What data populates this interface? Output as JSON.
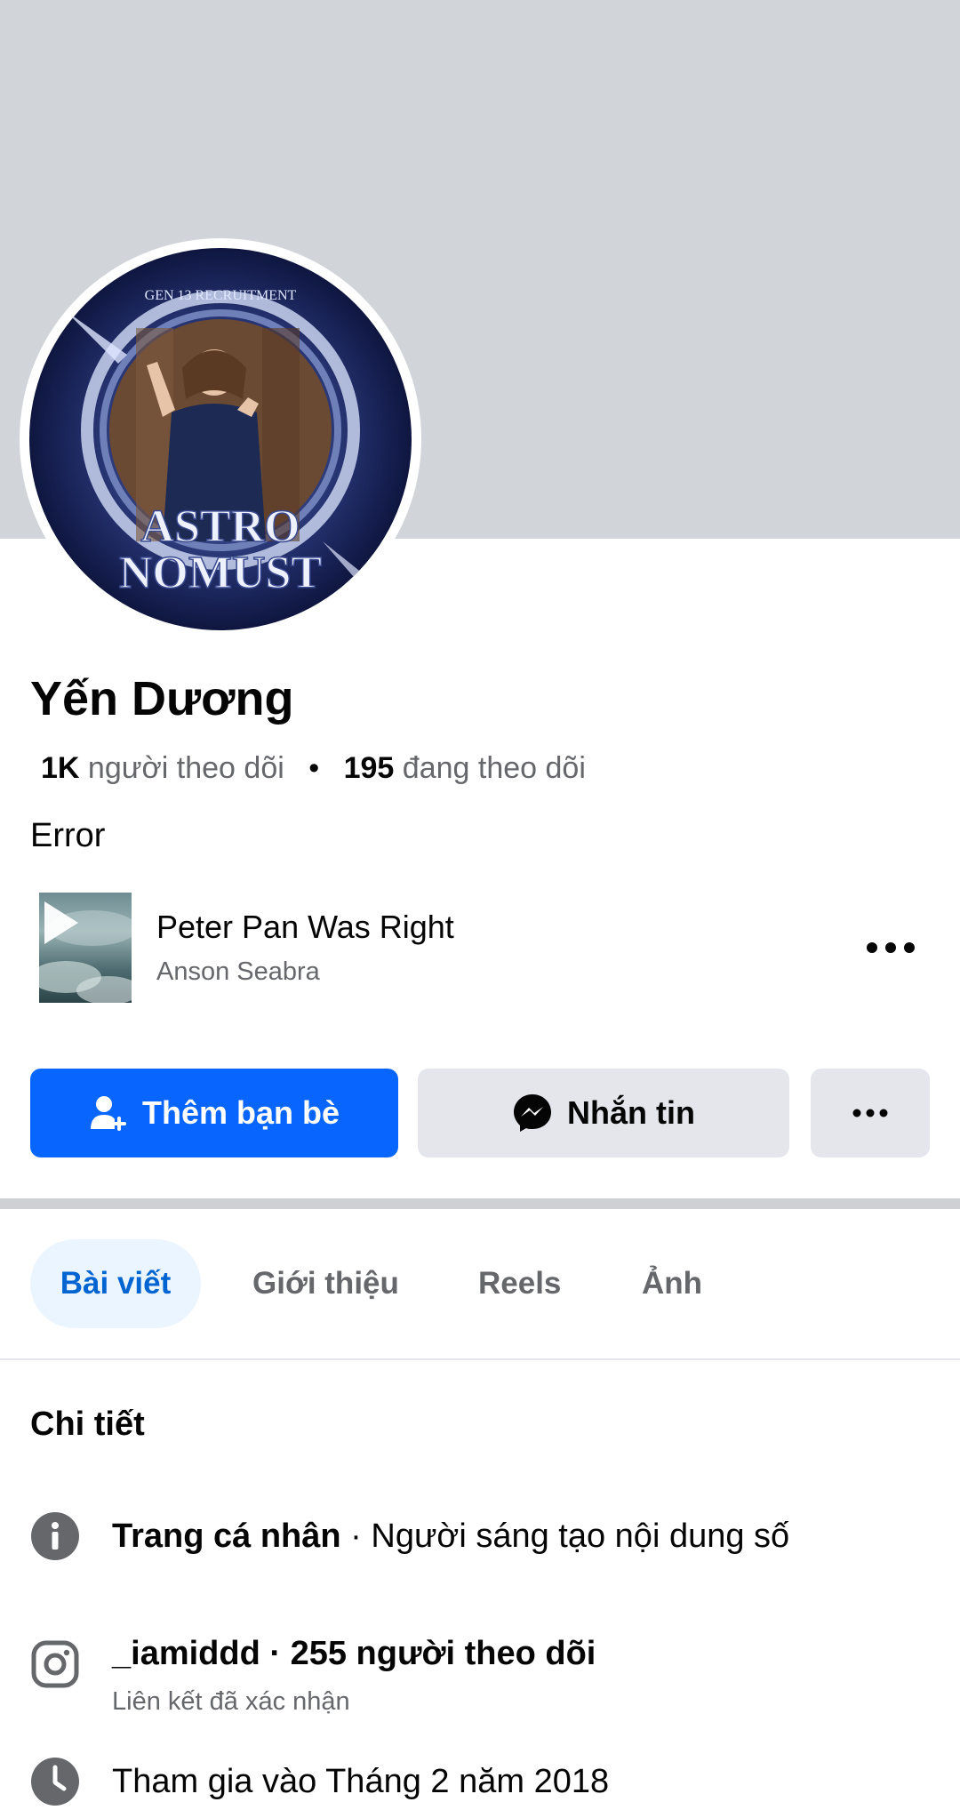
{
  "profile": {
    "name": "Yến Dương",
    "followers_count": "1K",
    "followers_label": "người theo dõi",
    "separator": "•",
    "following_count": "195",
    "following_label": "đang theo dõi",
    "bio": "Error"
  },
  "avatar": {
    "top_text": "GEN 13 RECRUITMENT",
    "logo_line1": "ASTRO",
    "logo_line2": "NOMUST"
  },
  "music": {
    "title": "Peter Pan Was Right",
    "artist": "Anson Seabra",
    "icon": "play-icon"
  },
  "actions": {
    "add_friend": "Thêm bạn bè",
    "message": "Nhắn tin"
  },
  "tabs": [
    {
      "label": "Bài viết",
      "active": true
    },
    {
      "label": "Giới thiệu",
      "active": false
    },
    {
      "label": "Reels",
      "active": false
    },
    {
      "label": "Ảnh",
      "active": false
    }
  ],
  "details": {
    "title": "Chi tiết",
    "page_type_bold": "Trang cá nhân",
    "page_type_rest": " · Người sáng tạo nội dung số",
    "instagram_text": "_iamiddd · 255 người theo dõi",
    "instagram_sub": "Liên kết đã xác nhận",
    "joined": "Tham gia vào Tháng 2 năm 2018"
  },
  "colors": {
    "brand_blue": "#0866ff",
    "cover_gray": "#d1d4d9",
    "secondary_button": "#e4e6eb",
    "muted_text": "#65676b"
  }
}
